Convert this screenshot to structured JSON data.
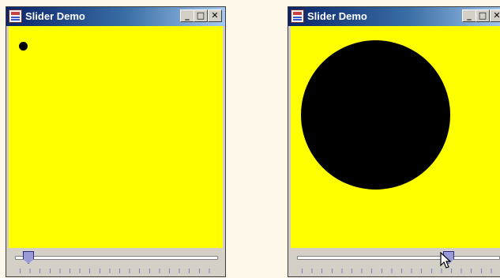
{
  "windows": [
    {
      "title": "Slider Demo",
      "controls": {
        "minimize": "_",
        "maximize": "□",
        "close": "✕"
      },
      "slider": {
        "min": 0,
        "max": 100,
        "value": 3,
        "tick_count": 21
      },
      "canvas": {
        "background": "#ffff00",
        "circle_color": "#000000"
      }
    },
    {
      "title": "Slider Demo",
      "controls": {
        "minimize": "_",
        "maximize": "□",
        "close": "✕"
      },
      "slider": {
        "min": 0,
        "max": 100,
        "value": 78,
        "tick_count": 21
      },
      "canvas": {
        "background": "#ffff00",
        "circle_color": "#000000"
      }
    }
  ],
  "icons": {
    "app": "java-cup-icon",
    "cursor": "arrow-cursor-icon"
  }
}
